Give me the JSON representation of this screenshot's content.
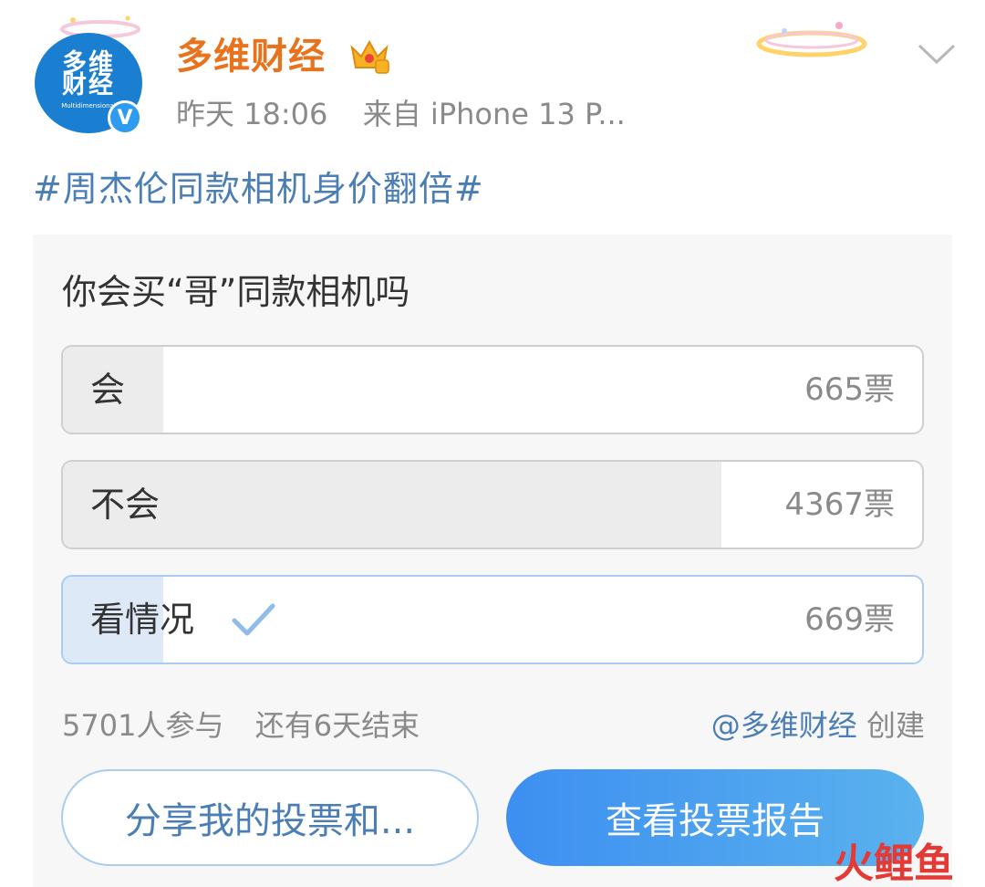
{
  "post": {
    "avatar_text_top": "多维",
    "avatar_text_bottom": "财经",
    "avatar_text_small": "Multidimensional",
    "verified_badge": "V",
    "username": "多维财经",
    "time": "昨天 18:06",
    "source": "来自 iPhone 13 P...",
    "topic": "#周杰伦同款相机身价翻倍#"
  },
  "poll": {
    "question": "你会买“哥”同款相机吗",
    "options": [
      {
        "label": "会",
        "votes": "665票",
        "share": 0.117,
        "selected": false
      },
      {
        "label": "不会",
        "votes": "4367票",
        "share": 0.766,
        "selected": false
      },
      {
        "label": "看情况",
        "votes": "669票",
        "share": 0.117,
        "selected": true
      }
    ],
    "participants": "5701人参与",
    "remaining": "还有6天结束",
    "creator_mention": "@多维财经",
    "creator_suffix": "创建",
    "share_button": "分享我的投票和...",
    "report_button": "查看投票报告"
  },
  "watermark": {
    "part1": "火",
    "part2": "鲤鱼"
  },
  "icons": {
    "menu": "chevron-down-icon",
    "crown": "crown-badge-icon",
    "check": "checkmark-icon",
    "verified": "verified-badge-icon"
  },
  "colors": {
    "username": "#e8731c",
    "link": "#4a7eb5",
    "accent_button": "#3d8ff0",
    "selected_fill": "#dde9f7",
    "verified": "#2c9bf0"
  }
}
